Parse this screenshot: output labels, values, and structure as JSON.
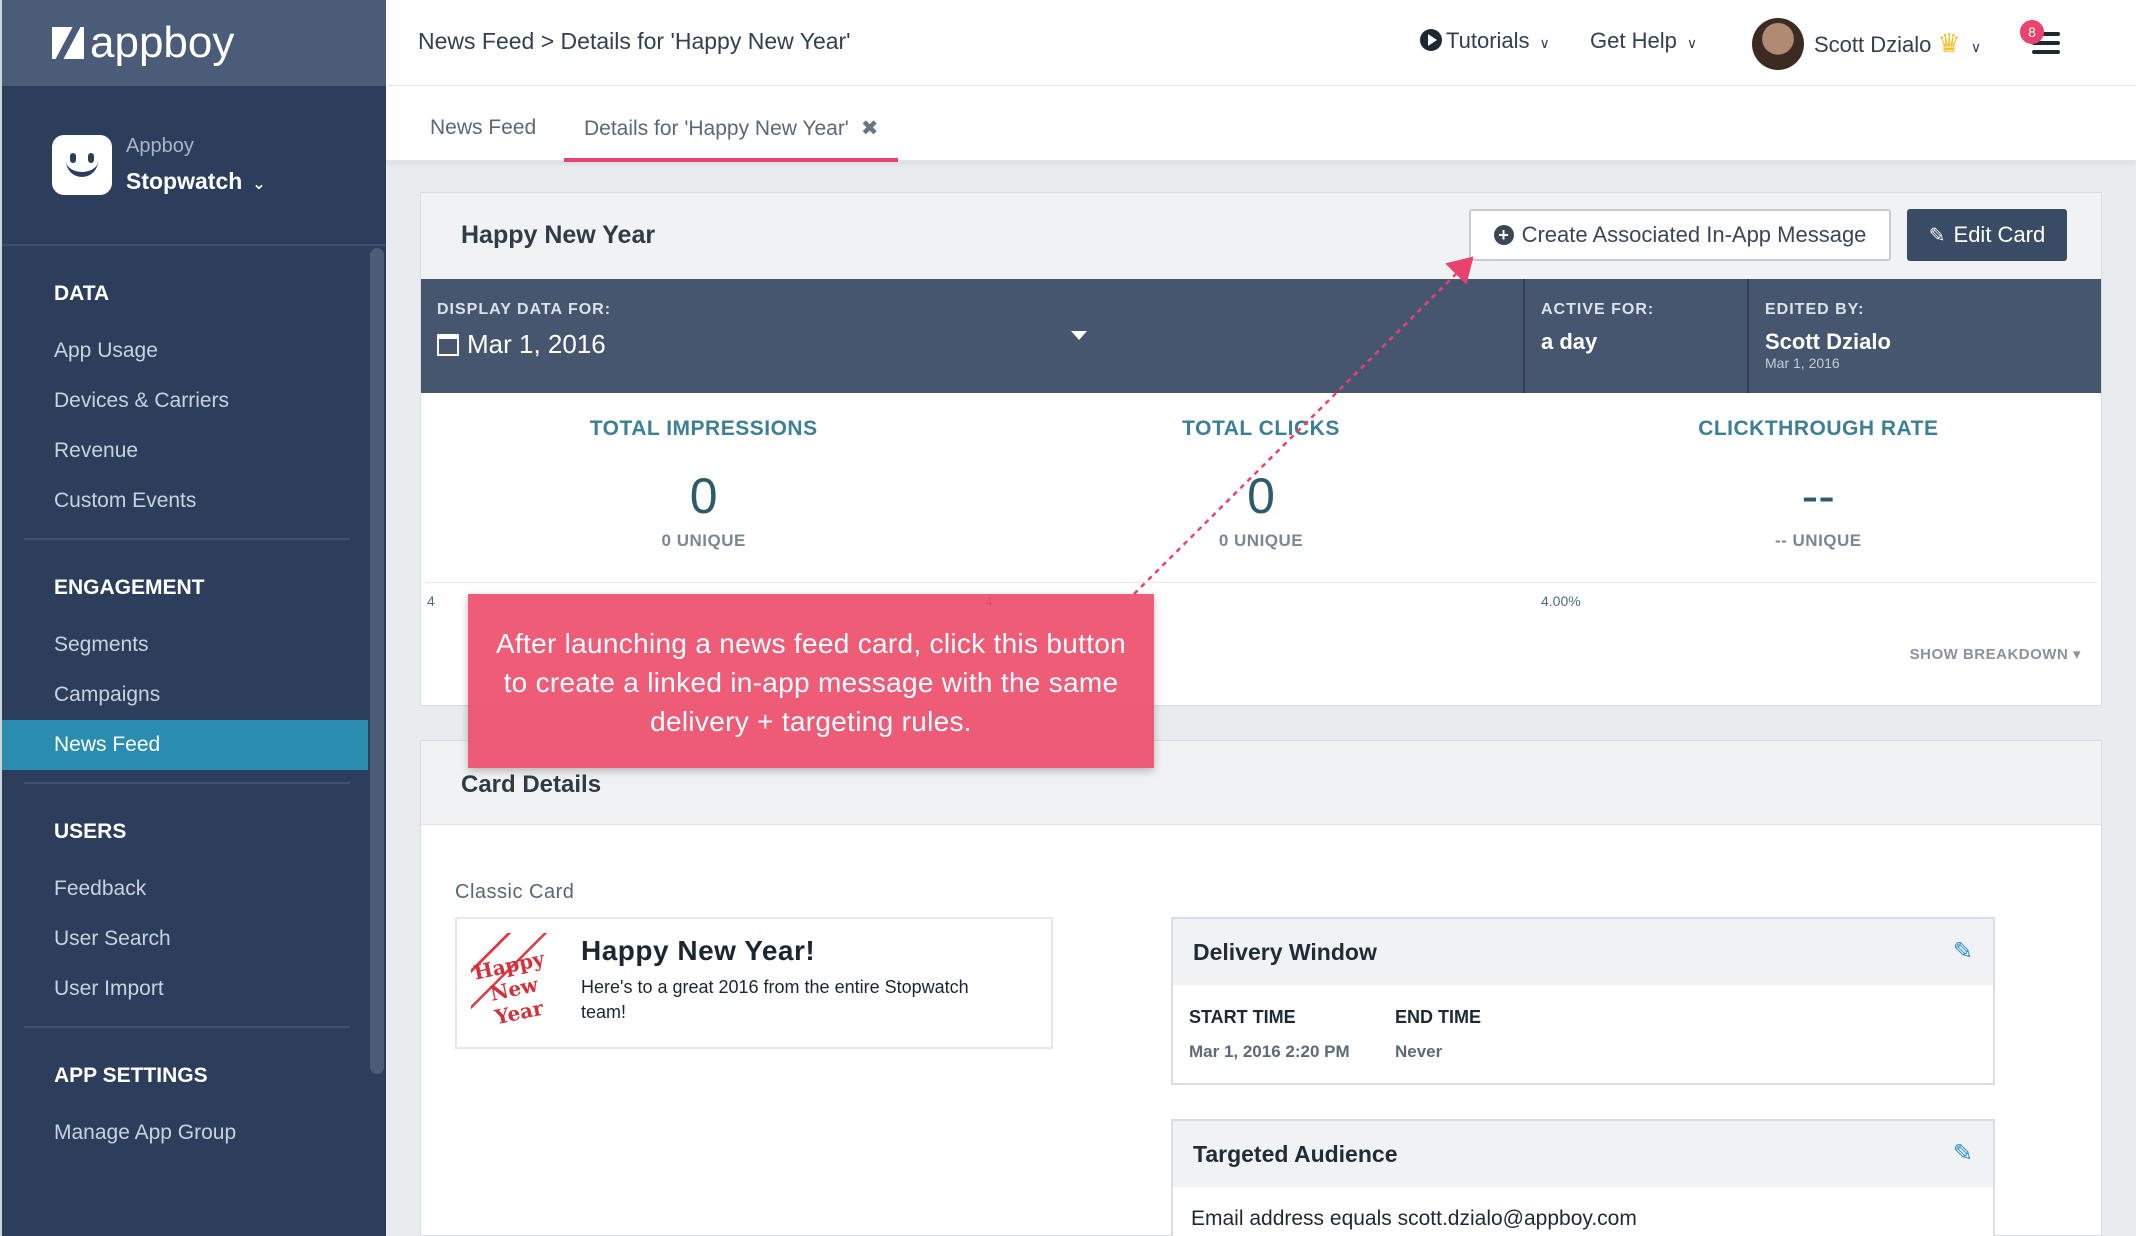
{
  "logo": {
    "text": "appboy"
  },
  "app": {
    "org": "Appboy",
    "name": "Stopwatch"
  },
  "sidebar": {
    "sections": [
      {
        "title": "DATA",
        "items": [
          "App Usage",
          "Devices & Carriers",
          "Revenue",
          "Custom Events"
        ]
      },
      {
        "title": "ENGAGEMENT",
        "items": [
          "Segments",
          "Campaigns",
          "News Feed"
        ]
      },
      {
        "title": "USERS",
        "items": [
          "Feedback",
          "User Search",
          "User Import"
        ]
      },
      {
        "title": "APP SETTINGS",
        "items": [
          "Manage App Group"
        ]
      }
    ],
    "active_item": "News Feed"
  },
  "topbar": {
    "breadcrumb": "News Feed > Details for 'Happy New Year'",
    "tutorials": "Tutorials",
    "help": "Get Help",
    "user": "Scott Dzialo",
    "notifications": "8"
  },
  "tabs": [
    {
      "label": "News Feed"
    },
    {
      "label": "Details for 'Happy New Year'"
    }
  ],
  "card": {
    "title": "Happy New Year",
    "create_button": "Create Associated In-App Message",
    "edit_button": "Edit Card",
    "display_label": "DISPLAY DATA FOR:",
    "display_date": "Mar 1, 2016",
    "active_label": "ACTIVE FOR:",
    "active_value": "a day",
    "edited_label": "EDITED BY:",
    "edited_by": "Scott Dzialo",
    "edited_date": "Mar 1, 2016"
  },
  "stats": [
    {
      "label": "TOTAL IMPRESSIONS",
      "value": "0",
      "sub": "0 UNIQUE"
    },
    {
      "label": "TOTAL CLICKS",
      "value": "0",
      "sub": "0 UNIQUE"
    },
    {
      "label": "CLICKTHROUGH RATE",
      "value": "--",
      "sub": "-- UNIQUE"
    }
  ],
  "chart_axis": [
    "4",
    "4",
    "4.00%"
  ],
  "show_breakdown": "SHOW BREAKDOWN ▾",
  "details": {
    "title": "Card Details",
    "classic_label": "Classic Card",
    "news_title": "Happy New Year!",
    "news_body": "Here's to a great 2016 from the entire Stopwatch team!",
    "image_text": "Happy New Year",
    "delivery": {
      "title": "Delivery Window",
      "start_label": "START TIME",
      "start_value": "Mar 1, 2016 2:20 PM",
      "end_label": "END TIME",
      "end_value": "Never"
    },
    "audience": {
      "title": "Targeted Audience",
      "rule": "Email address equals scott.dzialo@appboy.com"
    }
  },
  "annotation": {
    "text": "After launching a news feed card, click this button to create a linked in-app message with the same delivery + targeting rules."
  },
  "colors": {
    "accent": "#e8426e",
    "sidebar": "#2c3e5b",
    "active_nav": "#2a8db0",
    "callout": "#ee4e6c",
    "edit_icon": "#2a8fd6"
  }
}
